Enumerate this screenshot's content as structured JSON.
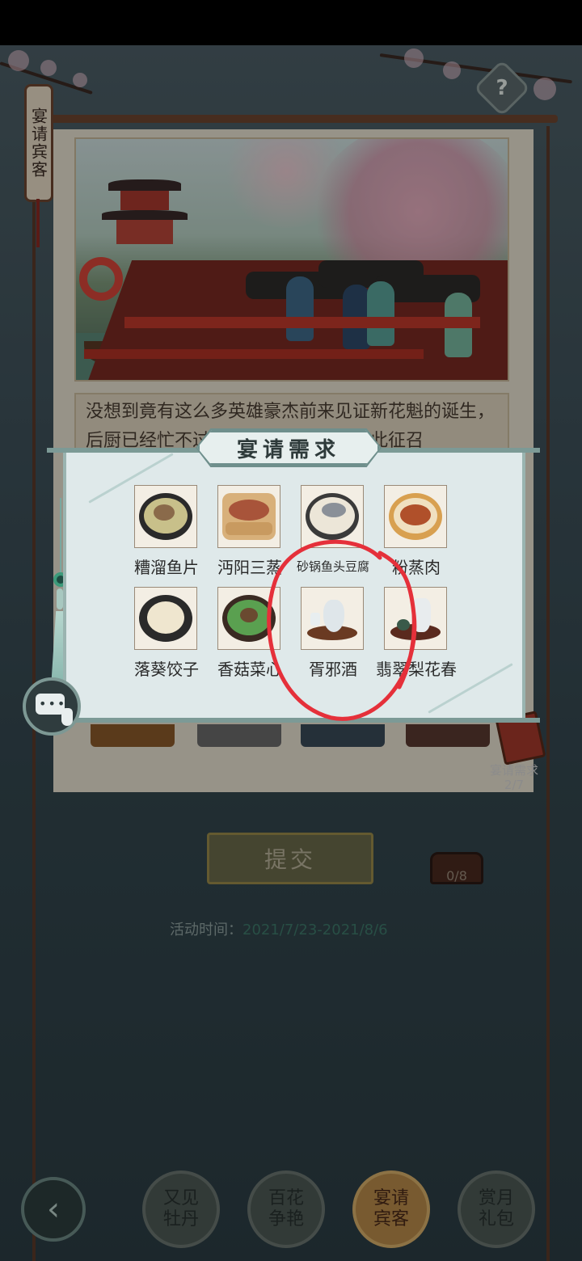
{
  "side_tag": {
    "label": "宴请宾客"
  },
  "help": {
    "icon": "question-icon",
    "label": "?"
  },
  "story": {
    "text": "没想到竟有这么多英雄豪杰前来见证新花魁的诞生，后厨已经忙不过来了，特此下令，特此征召"
  },
  "modal": {
    "title": "宴请需求",
    "dishes": [
      {
        "name": "糟溜鱼片",
        "icon": "fish-slice-dish-icon"
      },
      {
        "name": "沔阳三蒸",
        "icon": "steamer-dish-icon"
      },
      {
        "name": "砂锅鱼头豆腐",
        "icon": "fish-head-tofu-icon"
      },
      {
        "name": "粉蒸肉",
        "icon": "steamed-pork-icon"
      },
      {
        "name": "落葵饺子",
        "icon": "dumplings-icon"
      },
      {
        "name": "香菇菜心",
        "icon": "mushroom-greens-icon"
      },
      {
        "name": "胥邪酒",
        "icon": "wine-pot-icon"
      },
      {
        "name": "翡翠梨花春",
        "icon": "wine-jar-icon"
      }
    ]
  },
  "ledger": {
    "label": "宴请需求",
    "count": "2/7"
  },
  "submit": {
    "label": "提交"
  },
  "chest": {
    "count": "0/8"
  },
  "event_time": {
    "label": "活动时间：",
    "value": "2021/7/23-2021/8/6"
  },
  "bottom_nav": {
    "back_icon": "chevron-left-icon",
    "tabs": [
      {
        "label": "又见牡丹",
        "active": false
      },
      {
        "label": "百花争艳",
        "active": false
      },
      {
        "label": "宴请宾客",
        "active": true
      },
      {
        "label": "赏月礼包",
        "active": false
      }
    ]
  },
  "colors": {
    "annotation": "#e5303a",
    "modal_bg": "#dfe9ea",
    "accent_teal": "#3e7a6b"
  }
}
